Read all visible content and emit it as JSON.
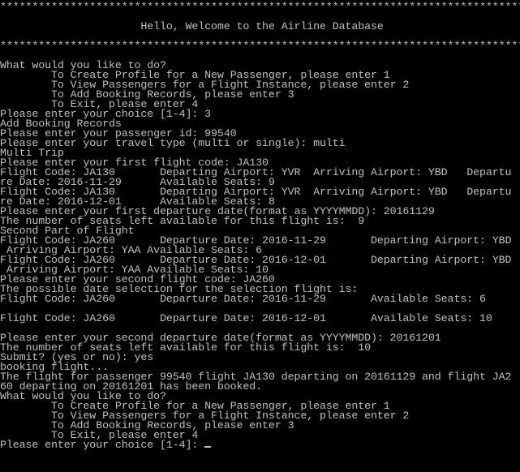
{
  "console": {
    "lines": [
      "*****************************************************************************************",
      "",
      "                      Hello, Welcome to the Airline Database",
      "",
      "*****************************************************************************************",
      "",
      "What would you like to do?",
      "        To Create Profile for a New Passenger, please enter 1",
      "        To View Passengers for a Flight Instance, please enter 2",
      "        To Add Booking Records, please enter 3",
      "        To Exit, please enter 4",
      "Please enter your choice [1-4]: 3",
      "Add Booking Records",
      "Please enter your passenger id: 99540",
      "Please enter your travel type (multi or single): multi",
      "Multi Trip",
      "Please enter your first flight code: JA130",
      "Flight Code: JA130       Departing Airport: YVR  Arriving Airport: YBD   Departu",
      "re Date: 2016-11-29      Available Seats: 9",
      "Flight Code: JA130       Departing Airport: YVR  Arriving Airport: YBD   Departu",
      "re Date: 2016-12-01      Available Seats: 8",
      "Please enter your first departure date(format as YYYYMMDD): 20161129",
      "The number of seats left available for this flight is:  9",
      "Second Part of Flight",
      "Flight Code: JA260       Departure Date: 2016-11-29       Departing Airport: YBD",
      " Arriving Airport: YAA Available Seats: 6",
      "Flight Code: JA260       Departure Date: 2016-12-01       Departing Airport: YBD",
      " Arriving Airport: YAA Available Seats: 10",
      "Please enter your second flight code: JA260",
      "The possible date selection for the selection flight is:",
      "Flight Code: JA260       Departure Date: 2016-11-29       Available Seats: 6",
      "",
      "Flight Code: JA260       Departure Date: 2016-12-01       Available Seats: 10",
      "",
      "Please enter your second departure date(format as YYYYMMDD): 20161201",
      "The number of seats left available for this flight is:  10",
      "Submit? (yes or no): yes",
      "booking flight...",
      "The flight for passenger 99540 flight JA130 departing on 20161129 and flight JA2",
      "60 departing on 20161201 has been booked.",
      "What would you like to do?",
      "        To Create Profile for a New Passenger, please enter 1",
      "        To View Passengers for a Flight Instance, please enter 2",
      "        To Add Booking Records, please enter 3",
      "        To Exit, please enter 4",
      "Please enter your choice [1-4]: "
    ]
  }
}
